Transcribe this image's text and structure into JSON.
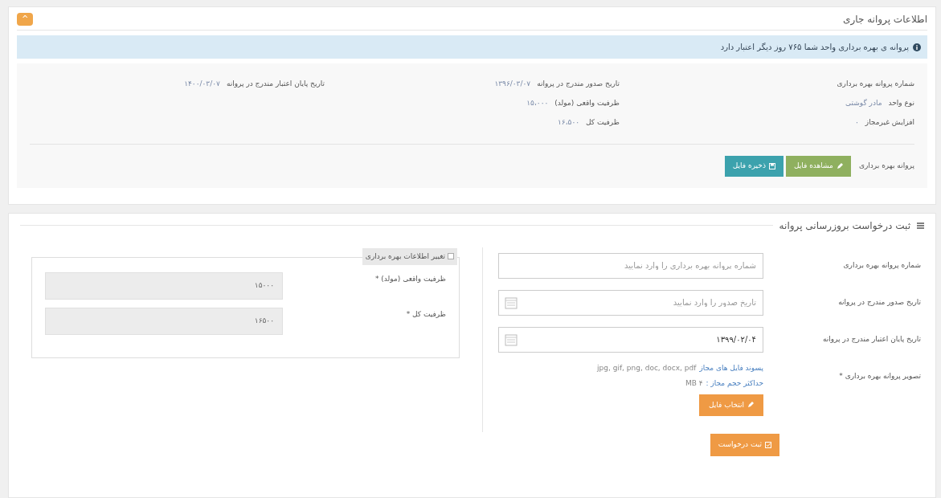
{
  "current_license": {
    "title": "اطلاعات پروانه جاری",
    "collapse_button": "^",
    "alert": "پروانه ی بهره برداری واحد شما ۷۶۵ روز دیگر اعتبار دارد",
    "info_rows": [
      [
        {
          "label": "شماره پروانه بهره برداری"
        },
        {
          "label": "تاریخ صدور مندرج در پروانه",
          "value": "۱۳۹۶/۰۳/۰۷"
        },
        {
          "label": "تاریخ پایان اعتبار مندرج در پروانه",
          "value": "۱۴۰۰/۰۳/۰۷"
        }
      ],
      [
        {
          "label": "نوع واحد",
          "value": "مادر گوشتی"
        },
        {
          "label": "ظرفیت واقعی (مولد)",
          "value": "۱۵،۰۰۰"
        }
      ],
      [
        {
          "label": "افزایش غیرمجاز",
          "value": "۰"
        },
        {
          "label": "ظرفیت کل",
          "value": "۱۶،۵۰۰"
        }
      ]
    ],
    "file_label": "پروانه بهره برداری",
    "buttons": [
      {
        "kind": "view",
        "label": "مشاهده فایل"
      },
      {
        "kind": "save",
        "label": "ذخیره فایل"
      }
    ]
  },
  "update_request": {
    "title": "ثبت درخواست بروزرسانی پروانه",
    "fields": [
      {
        "kind": "text",
        "label": "شماره پروانه بهره برداری",
        "placeholder": "شماره پروانه بهره برداری را وارد نمایید"
      },
      {
        "kind": "date",
        "label": "تاریخ صدور مندرج در پروانه",
        "placeholder": "تاریخ صدور را وارد نمایید"
      },
      {
        "kind": "date",
        "label": "تاریخ پایان اعتبار مندرج در پروانه",
        "value": "۱۳۹۹/۰۲/۰۴"
      }
    ],
    "upload": {
      "label": "تصویر پروانه بهره برداری *",
      "extensions_label": "پسوند فایل های مجاز",
      "extensions": "jpg, gif, png, doc, docx, pdf",
      "size_label": "حداکثر حجم مجاز :",
      "size": "۴ MB",
      "button": "انتخاب فایل"
    },
    "change_box": {
      "legend": "تغییر اطلاعات بهره برداری",
      "checked": false,
      "fields": [
        {
          "label": "ظرفیت واقعی (مولد) *",
          "value": "۱۵۰۰۰"
        },
        {
          "label": "ظرفیت کل *",
          "value": "۱۶۵۰۰"
        }
      ]
    },
    "submit": "ثبت درخواست"
  }
}
